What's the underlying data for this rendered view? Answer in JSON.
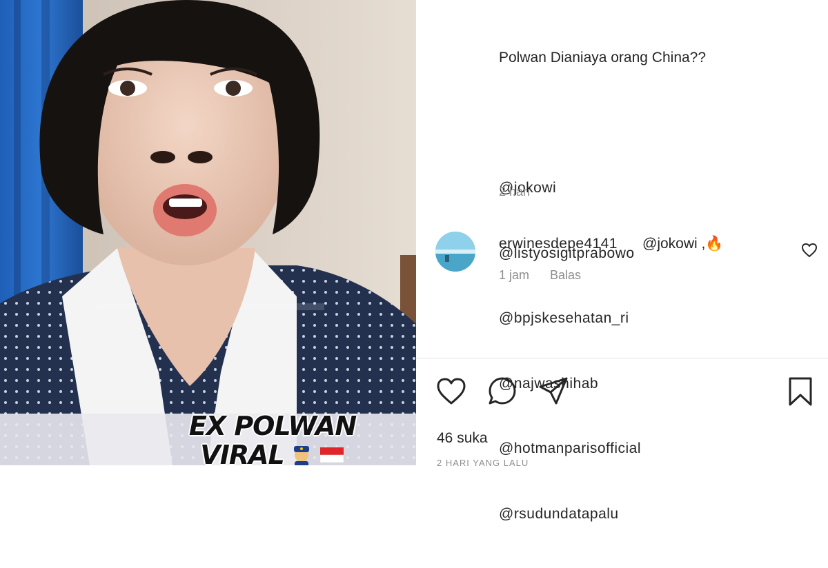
{
  "media": {
    "overlay_line1": "EX POLWAN",
    "overlay_line2": "VIRAL",
    "overlay_emojis": [
      "police-officer-emoji",
      "indonesia-flag-emoji"
    ]
  },
  "post": {
    "caption_lines": [
      "Polwan Dianiaya orang China??",
      "",
      "@jokowi",
      "@listyosigitprabowo",
      "@bpjskesehatan_ri",
      "@najwashihab",
      "@hotmanparisofficial",
      "@rsudundatapalu"
    ],
    "time": "2 hari"
  },
  "comment": {
    "username": "erwinesdepe4141",
    "text": "@jokowi ,🔥",
    "time": "1 jam",
    "reply_label": "Balas"
  },
  "actions": {
    "likes": "46 suka",
    "date_ago": "2 HARI YANG LALU"
  },
  "colors": {
    "text": "#262626",
    "muted": "#8e8e8e",
    "divider": "#e6e6e6"
  }
}
